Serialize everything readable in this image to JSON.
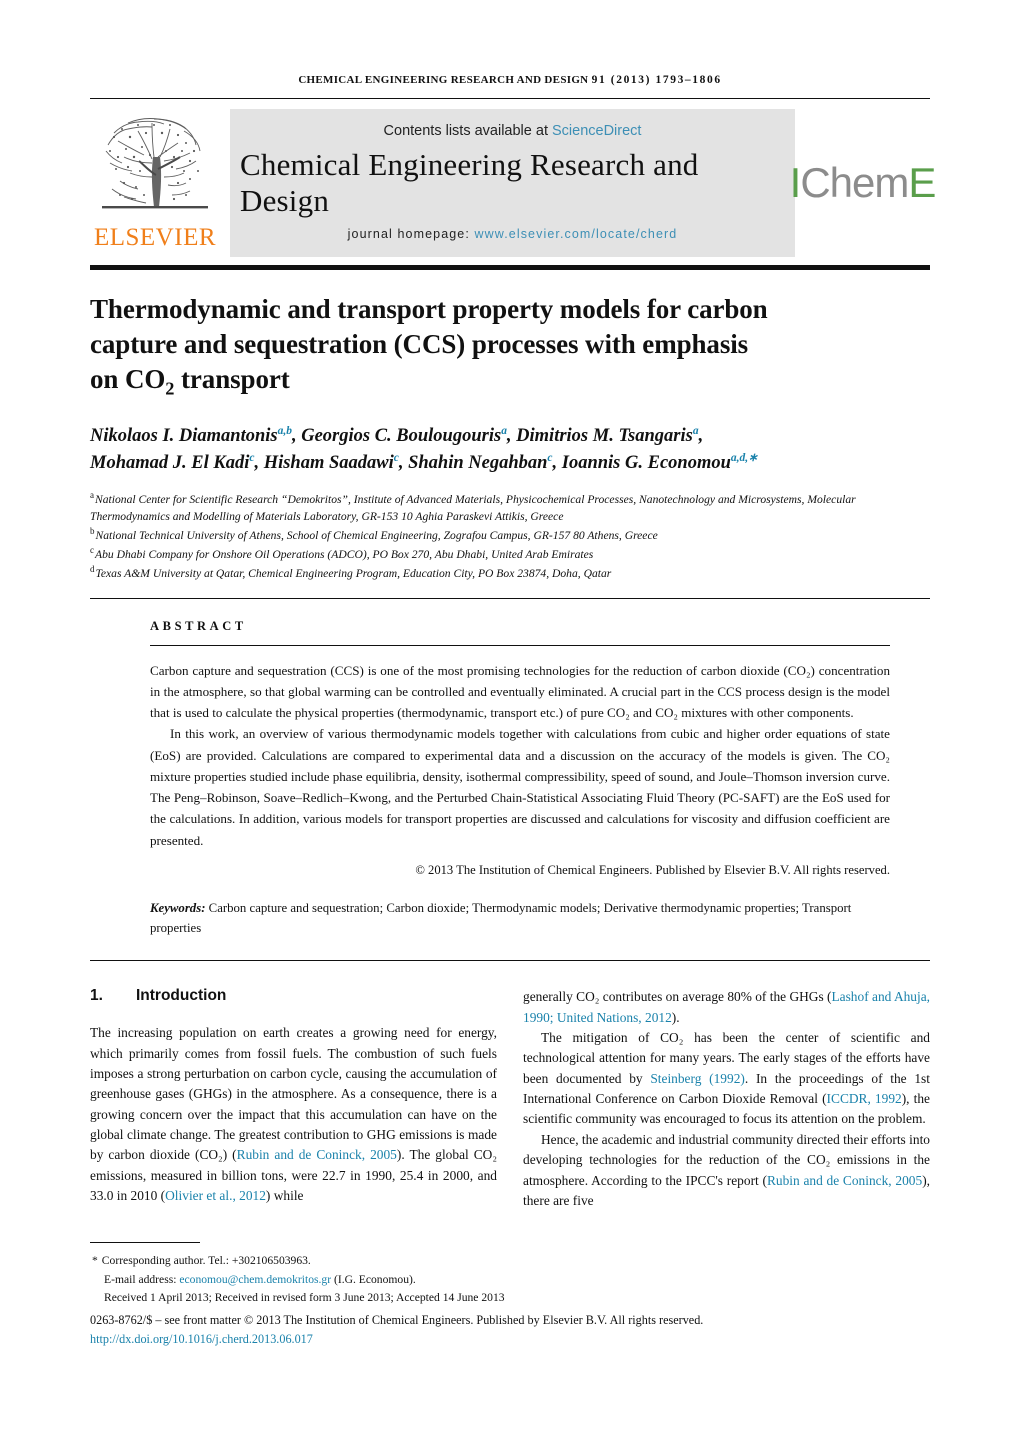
{
  "running_head": {
    "journal": "Chemical Engineering Research and Design",
    "volume_year_pages": "91 (2013) 1793–1806"
  },
  "masthead": {
    "elsevier_wordmark": "ELSEVIER",
    "contents_prefix": "Contents lists available at",
    "sciencedirect_link": "ScienceDirect",
    "journal_title": "Chemical Engineering Research and Design",
    "homepage_label": "journal homepage:",
    "homepage_url": "www.elsevier.com/locate/cherd",
    "icheme_part1": "I",
    "icheme_part2": "Chem",
    "icheme_part3": "E"
  },
  "article": {
    "title_line1": "Thermodynamic and transport property models for carbon",
    "title_line2": "capture and sequestration (CCS) processes with emphasis",
    "title_line3_pre": "on CO",
    "title_line3_sub": "2",
    "title_line3_post": " transport"
  },
  "authors": [
    {
      "name": "Nikolaos I. Diamantonis",
      "marks": "a,b",
      "sep": ", "
    },
    {
      "name": "Georgios C. Boulougouris",
      "marks": "a",
      "sep": ", "
    },
    {
      "name": "Dimitrios M. Tsangaris",
      "marks": "a",
      "sep": ","
    },
    {
      "name": "Mohamad J. El Kadi",
      "marks": "c",
      "sep": ", "
    },
    {
      "name": "Hisham Saadawi",
      "marks": "c",
      "sep": ", "
    },
    {
      "name": "Shahin Negahban",
      "marks": "c",
      "sep": ", "
    },
    {
      "name": "Ioannis G. Economou",
      "marks": "a,d,∗",
      "sep": ""
    }
  ],
  "affiliations": [
    {
      "mark": "a",
      "text": "National Center for Scientific Research “Demokritos”, Institute of Advanced Materials, Physicochemical Processes, Nanotechnology and Microsystems, Molecular Thermodynamics and Modelling of Materials Laboratory, GR-153 10 Aghia Paraskevi Attikis, Greece"
    },
    {
      "mark": "b",
      "text": "National Technical University of Athens, School of Chemical Engineering, Zografou Campus, GR-157 80 Athens, Greece"
    },
    {
      "mark": "c",
      "text": "Abu Dhabi Company for Onshore Oil Operations (ADCO), PO Box 270, Abu Dhabi, United Arab Emirates"
    },
    {
      "mark": "d",
      "text": "Texas A&M University at Qatar, Chemical Engineering Program, Education City, PO Box 23874, Doha, Qatar"
    }
  ],
  "abstract": {
    "label": "Abstract",
    "para1": "Carbon capture and sequestration (CCS) is one of the most promising technologies for the reduction of carbon dioxide (CO₂) concentration in the atmosphere, so that global warming can be controlled and eventually eliminated. A crucial part in the CCS process design is the model that is used to calculate the physical properties (thermodynamic, transport etc.) of pure CO₂ and CO₂ mixtures with other components.",
    "para2": "In this work, an overview of various thermodynamic models together with calculations from cubic and higher order equations of state (EoS) are provided. Calculations are compared to experimental data and a discussion on the accuracy of the models is given. The CO₂ mixture properties studied include phase equilibria, density, isothermal compressibility, speed of sound, and Joule–Thomson inversion curve. The Peng–Robinson, Soave–Redlich–Kwong, and the Perturbed Chain-Statistical Associating Fluid Theory (PC-SAFT) are the EoS used for the calculations. In addition, various models for transport properties are discussed and calculations for viscosity and diffusion coefficient are presented.",
    "copyright": "© 2013 The Institution of Chemical Engineers. Published by Elsevier B.V. All rights reserved.",
    "keywords_label": "Keywords:",
    "keywords_text": "Carbon capture and sequestration; Carbon dioxide; Thermodynamic models; Derivative thermodynamic properties; Transport properties"
  },
  "body": {
    "section_number": "1.",
    "section_title": "Introduction",
    "left_para1_a": "The increasing population on earth creates a growing need for energy, which primarily comes from fossil fuels. The combustion of such fuels imposes a strong perturbation on carbon cycle, causing the accumulation of greenhouse gases (GHGs) in the atmosphere. As a consequence, there is a growing concern over the impact that this accumulation can have on the global climate change. The greatest contribution to GHG emissions is made by carbon dioxide (CO₂) (",
    "left_ref1": "Rubin and de Coninck, 2005",
    "left_para1_b": "). The global CO₂ emissions, measured in billion tons, were 22.7 in 1990, 25.4 in 2000, and 33.0 in 2010 (",
    "left_ref2": "Olivier et al., 2012",
    "left_para1_c": ") while",
    "right_para1_a": "generally CO₂ contributes on average 80% of the GHGs (",
    "right_ref1": "Lashof and Ahuja, 1990; United Nations, 2012",
    "right_para1_b": ").",
    "right_para2_a": "The mitigation of CO₂ has been the center of scientific and technological attention for many years. The early stages of the efforts have been documented by ",
    "right_ref2": "Steinberg (1992)",
    "right_para2_b": ". In the proceedings of the 1st International Conference on Carbon Dioxide Removal (",
    "right_ref3": "ICCDR, 1992",
    "right_para2_c": "), the scientific community was encouraged to focus its attention on the problem.",
    "right_para3_a": "Hence, the academic and industrial community directed their efforts into developing technologies for the reduction of the CO₂ emissions in the atmosphere. According to the IPCC's report (",
    "right_ref4": "Rubin and de Coninck, 2005",
    "right_para3_b": "), there are five"
  },
  "footnote": {
    "corresponding": "Corresponding author. Tel.: +302106503963.",
    "email_label": "E-mail address:",
    "email": "economou@chem.demokritos.gr",
    "email_suffix": "(I.G. Economou).",
    "history": "Received 1 April 2013; Received in revised form 3 June 2013; Accepted 14 June 2013",
    "issn_line": "0263-8762/$ – see front matter © 2013 The Institution of Chemical Engineers. Published by Elsevier B.V. All rights reserved.",
    "doi": "http://dx.doi.org/10.1016/j.cherd.2013.06.017"
  },
  "colors": {
    "link": "#1a82ab",
    "sciencedirect": "#3d8fb5",
    "elsevier_orange": "#F07F1A",
    "icheme_green": "#5a9e4b",
    "icheme_gray": "#8c8c8c",
    "banner_bg": "#e3e3e3"
  }
}
